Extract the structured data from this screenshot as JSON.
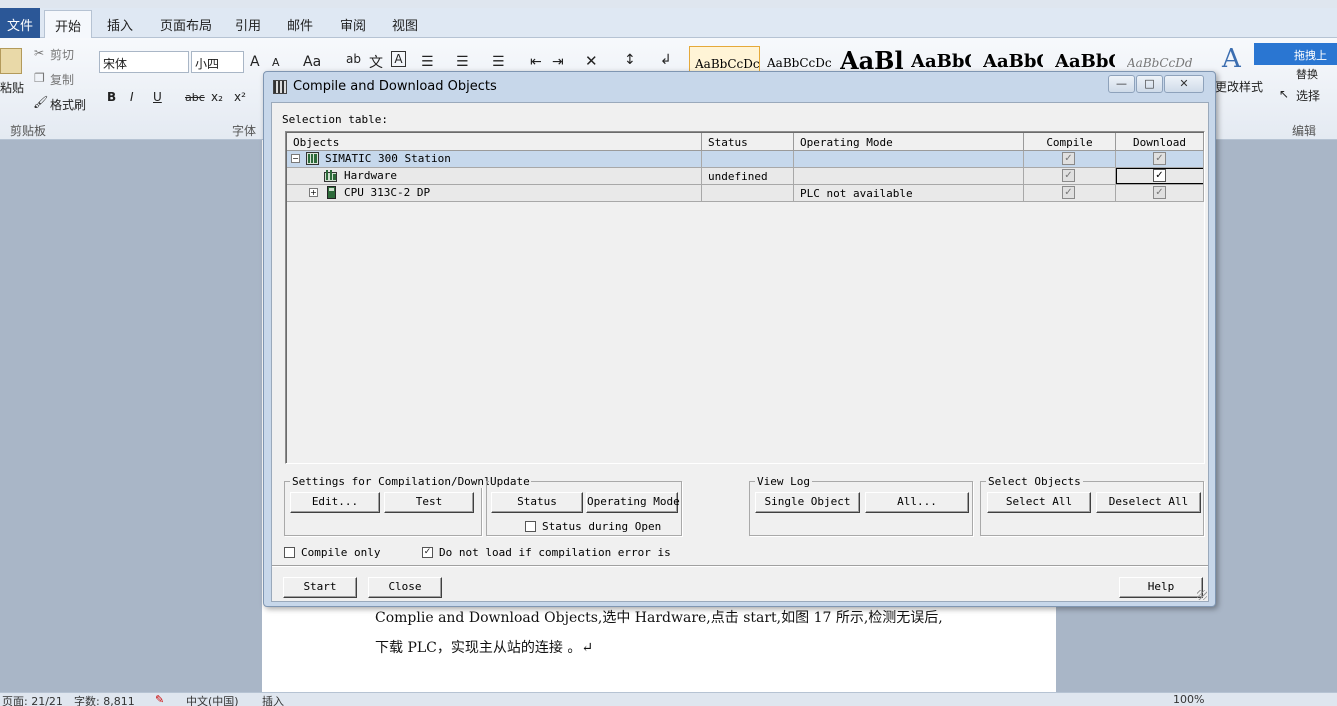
{
  "word": {
    "tabs": [
      "文件",
      "开始",
      "插入",
      "页面布局",
      "引用",
      "邮件",
      "审阅",
      "视图"
    ],
    "clipboard": {
      "paste": "粘贴",
      "cut": "剪切",
      "copy": "复制",
      "format_painter": "格式刷",
      "group": "剪贴板"
    },
    "font": {
      "name": "宋体",
      "size": "小四",
      "group": "字体",
      "grow": "A",
      "shrink": "A",
      "aa": "Aa",
      "bold": "B",
      "italic": "I",
      "underline": "U",
      "strike": "abc",
      "sub": "x₂",
      "sup": "x²"
    },
    "styles": [
      "AaBbCcDc",
      "AaBbCcDc",
      "AaBl",
      "AaBbC",
      "AaBbC",
      "AaBbC",
      "AaBbCcDd"
    ],
    "change_styles": "更改样式",
    "editing": {
      "replace": "替换",
      "select": "选择",
      "group": "编辑"
    },
    "cloud_button": "拖拽上传",
    "doc_lines": [
      "Complie and Download Objects,选中 Hardware,点击 start,如图 17 所示,检测无误后,",
      "下载 PLC，实现主从站的连接 。↵"
    ],
    "status": {
      "page": "页面: 21/21",
      "words": "字数: 8,811",
      "lang": "中文(中国)",
      "mode": "插入",
      "zoom": "100%"
    }
  },
  "dialog": {
    "title": "Compile and Download Objects",
    "window_buttons": {
      "minimize": "—",
      "maximize": "□",
      "close": "✕"
    },
    "selection_label": "Selection table:",
    "columns": [
      "Objects",
      "Status",
      "Operating Mode",
      "Compile",
      "Download"
    ],
    "rows": [
      {
        "object": "SIMATIC 300 Station",
        "status": "",
        "mode": "",
        "compile": true,
        "download": true,
        "expander": "−"
      },
      {
        "object": "Hardware",
        "status": "undefined",
        "mode": "",
        "compile": true,
        "download": true,
        "expander": ""
      },
      {
        "object": "CPU 313C-2 DP",
        "status": "",
        "mode": "PLC not available",
        "compile": true,
        "download": true,
        "expander": "+"
      }
    ],
    "groups": {
      "settings": {
        "label": "Settings for Compilation/Download",
        "edit": "Edit...",
        "test": "Test"
      },
      "update": {
        "label": "Update",
        "status": "Status",
        "operating_mode": "Operating Mode",
        "status_during_open": "Status during Open"
      },
      "view_log": {
        "label": "View Log",
        "single": "Single Object",
        "all": "All..."
      },
      "select_objects": {
        "label": "Select Objects",
        "select_all": "Select All",
        "deselect_all": "Deselect All"
      }
    },
    "compile_only": {
      "label": "Compile only",
      "checked": false
    },
    "no_load_on_error": {
      "label": "Do not load if compilation error is",
      "checked": true
    },
    "buttons": {
      "start": "Start",
      "close": "Close",
      "help": "Help"
    }
  }
}
